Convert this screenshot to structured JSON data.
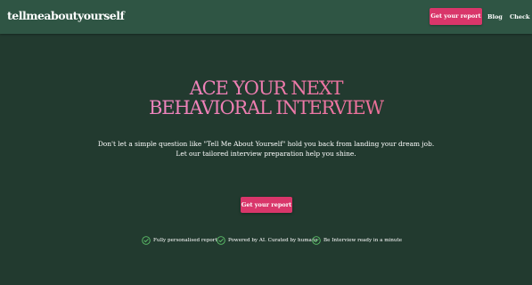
{
  "nav": {
    "logo": "tellmeaboutyourself",
    "cta_label": "Get your report",
    "links": [
      "Blog",
      "Check S..."
    ]
  },
  "hero": {
    "title_line1": "ACE YOUR NEXT",
    "title_line2": "BEHAVIORAL INTERVIEW",
    "subtitle_line1": "Don't let a simple question like \"Tell Me About Yourself\" hold you back from landing your dream job.",
    "subtitle_line2": "Let our tailored interview preparation help you shine.",
    "cta_label": "Get your report"
  },
  "features": [
    {
      "icon": "check-circle-icon",
      "label": "Fully personalised report"
    },
    {
      "icon": "check-circle-icon",
      "label": "Powered by AI. Curated by humans"
    },
    {
      "icon": "check-circle-icon",
      "label": "Be Interview ready in a minute"
    }
  ],
  "colors": {
    "background": "#223a2f",
    "header": "#2f5544",
    "accent": "#d9366a",
    "title_gradient_start": "#f28fd6",
    "title_gradient_end": "#e85f7a",
    "check": "#5ec26a"
  }
}
